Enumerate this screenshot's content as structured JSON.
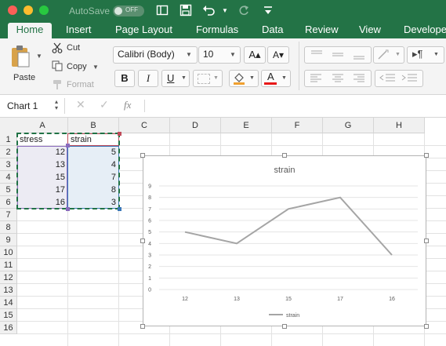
{
  "titlebar": {
    "autosave_label": "AutoSave",
    "autosave_state": "OFF",
    "icons": [
      "sidebar-icon",
      "save-icon",
      "undo-icon",
      "redo-icon",
      "customize-icon"
    ]
  },
  "tabs": [
    "Home",
    "Insert",
    "Page Layout",
    "Formulas",
    "Data",
    "Review",
    "View",
    "Develope"
  ],
  "ribbon": {
    "paste": "Paste",
    "cut": "Cut",
    "copy": "Copy",
    "format": "Format",
    "font_name": "Calibri (Body)",
    "font_size": "10",
    "bold": "B",
    "italic": "I",
    "underline": "U",
    "grow": "A▴",
    "shrink": "A▾",
    "font_color_letter": "A",
    "fill_color": "#f0a030",
    "font_color": "#e81818"
  },
  "formulabar": {
    "name_box": "Chart 1",
    "fx": "fx",
    "cancel": "✕",
    "confirm": "✓",
    "value": ""
  },
  "grid": {
    "columns": [
      "A",
      "B",
      "C",
      "D",
      "E",
      "F",
      "G",
      "H"
    ],
    "rows": [
      "1",
      "2",
      "3",
      "4",
      "5",
      "6",
      "7",
      "8",
      "9",
      "10",
      "11",
      "12",
      "13",
      "14",
      "15",
      "16"
    ],
    "headers": [
      "stress",
      "strain"
    ],
    "stress": [
      "12",
      "13",
      "15",
      "17",
      "16"
    ],
    "strain": [
      "5",
      "4",
      "7",
      "8",
      "3"
    ]
  },
  "chart_data": {
    "type": "line",
    "title": "strain",
    "categories": [
      "12",
      "13",
      "15",
      "17",
      "16"
    ],
    "series": [
      {
        "name": "strain",
        "values": [
          5,
          4,
          7,
          8,
          3
        ]
      }
    ],
    "ylim": [
      0,
      9
    ],
    "yticks": [
      "0",
      "1",
      "2",
      "3",
      "4",
      "5",
      "6",
      "7",
      "8",
      "9"
    ],
    "grid": true,
    "legend": "bottom",
    "line_color": "#a5a5a5"
  }
}
